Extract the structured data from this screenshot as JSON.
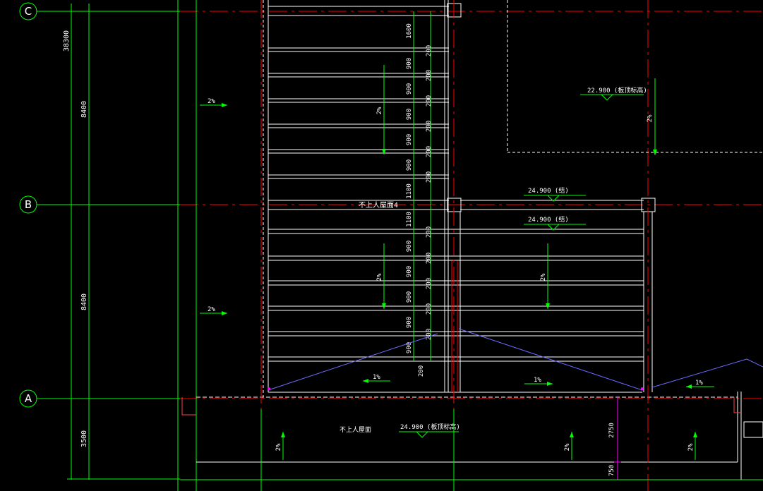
{
  "axes": {
    "c": "C",
    "b": "B",
    "a": "A"
  },
  "dims_left": {
    "total": "38300",
    "span_cb": "8400",
    "span_ba": "8400",
    "span_bottom": "3500"
  },
  "stack_dims": {
    "top": "1600",
    "d1": "900",
    "d2": "900",
    "d3": "900",
    "d4": "900",
    "d5": "900",
    "d6": "1100",
    "d7": "1100",
    "d8": "900",
    "d9": "900",
    "d10": "900",
    "d11": "900",
    "d12": "900",
    "bottom": "200"
  },
  "small_dims": [
    "200",
    "200",
    "200",
    "200",
    "200",
    "200",
    "200",
    "200",
    "200",
    "200",
    "200",
    "200",
    "200"
  ],
  "slopes": {
    "s2pct": "2%",
    "s1pct": "1%"
  },
  "levels": {
    "roof_top": "22.900 (板顶标高)",
    "mid1": "24.900 (结)",
    "mid2": "24.900 (结)",
    "bottom": "24.900 (板顶标高)"
  },
  "labels": {
    "roof_b": "不上人屋面4",
    "roof_a": "不上人屋面"
  },
  "right_dims": {
    "upper": "2750",
    "lower": "750"
  },
  "colors": {
    "grid_green": "#00ff00",
    "axis_red": "#ff0000",
    "wall_white": "#ffffff",
    "blue_line": "#6a6aff",
    "magenta": "#ff00ff"
  }
}
